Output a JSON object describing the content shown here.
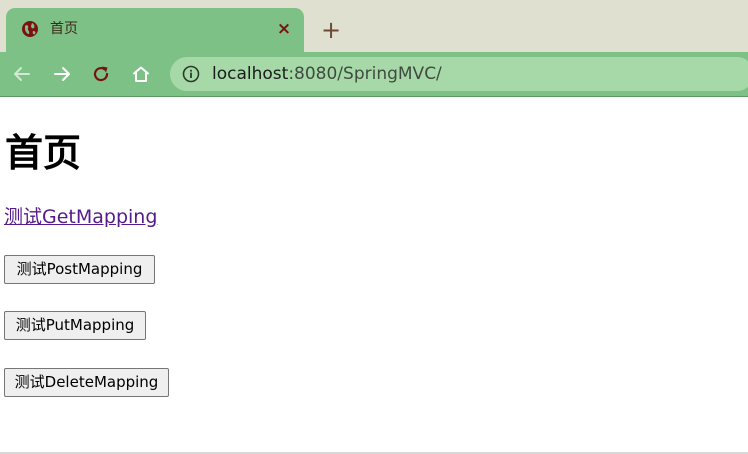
{
  "browser": {
    "tab": {
      "title": "首页",
      "favicon": "globe-icon",
      "close": "×"
    },
    "new_tab": "+",
    "address": {
      "host": "localhost",
      "path": ":8080/SpringMVC/"
    },
    "colors": {
      "chrome": "#7dc187",
      "tabstrip": "#dfe0cf",
      "omnibox": "#a7d9a8"
    }
  },
  "page": {
    "title": "首页",
    "link_label": "测试GetMapping",
    "buttons": {
      "post": "测试PostMapping",
      "put": "测试PutMapping",
      "delete": "测试DeleteMapping"
    }
  }
}
